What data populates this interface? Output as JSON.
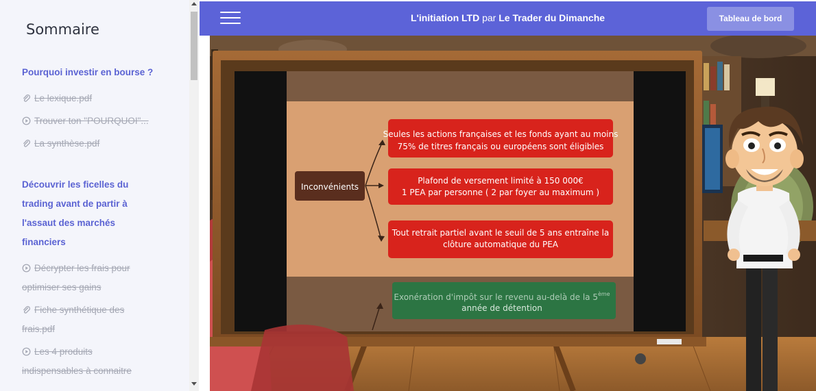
{
  "sidebar": {
    "title": "Sommaire",
    "sections": [
      {
        "label": "Pourquoi investir en bourse ?",
        "items": [
          {
            "label": "Le lexique.pdf",
            "icon": "paperclip-icon"
          },
          {
            "label": "Trouver ton \"POURQUOI\"...",
            "icon": "play-circle-icon"
          },
          {
            "label": "La synthèse.pdf",
            "icon": "paperclip-icon"
          }
        ]
      },
      {
        "label": "Découvrir les ficelles du trading avant de partir à l'assaut des marchés financiers",
        "items": [
          {
            "label": "Décrypter les frais pour optimiser ses gains",
            "icon": "play-circle-icon"
          },
          {
            "label": "Fiche synthétique des frais.pdf",
            "icon": "paperclip-icon"
          },
          {
            "label": "Les 4 produits indispensables à connaitre",
            "icon": "play-circle-icon"
          }
        ]
      }
    ]
  },
  "header": {
    "title_bold": "L'initiation LTD",
    "title_mid": "par",
    "title_brand": "Le Trader du Dimanche",
    "dashboard_label": "Tableau de bord",
    "bg_color": "#5c63d8"
  },
  "video": {
    "slide": {
      "center_box": "Inconvénients",
      "bullets": [
        "Seules les actions françaises et les fonds ayant au moins",
        "75% de titres français ou européens sont éligibles",
        "Plafond de versement limité à 150 000€",
        "1 PEA par personne ( 2 par foyer au maximum )",
        "Tout retrait partiel avant le seuil de 5 ans entraîne la",
        "clôture automatique du PEA"
      ],
      "green_box_line1": "Exonération d'impôt sur le revenu au-delà de la 5",
      "green_box_sup": "ème",
      "green_box_line2": "année de détention"
    }
  }
}
